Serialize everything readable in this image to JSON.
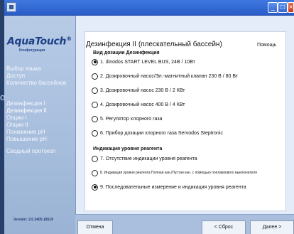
{
  "sidebar": {
    "logo": "AquaTouch",
    "logo_sub": "Конфигурация",
    "items_group1": [
      "Выбор языка",
      "Доступ",
      "Количество бассейнов"
    ],
    "items_group2": [
      "Дезинфекция I",
      "Дезинфекция II",
      "Опции I",
      "Опции II",
      "Понижение pH",
      "Повышение pH"
    ],
    "items_group3": [
      "Сводный протокол"
    ],
    "active_item": "Дезинфекция II",
    "version": "Version: 2.0.3405.18519"
  },
  "main": {
    "title": "Дезинфекция II (плескательный бассейн)",
    "help_label": "Помощь",
    "section1_title": "Вид дозации Дезинфекция",
    "dosing_options": [
      {
        "label": "1. dinodos START LEVEL BUS, 24В / 10Вт",
        "selected": true
      },
      {
        "label": "2. Дозировочный насос/Эл.-магнитный клапан 230 В / 80 Вт",
        "selected": false
      },
      {
        "label": "3. Дозировочный насос 230 В / 2 КВт",
        "selected": false
      },
      {
        "label": "4. Дозировочный насос 400 В / 4 КВт",
        "selected": false
      },
      {
        "label": "5. Регулятор хлорного газа",
        "selected": false
      },
      {
        "label": "6. Прибор дозации хлорного газа Servodos Steptronic",
        "selected": false
      }
    ],
    "section2_title": "Индикация уровня реагента",
    "level_options": [
      {
        "label": "7. Отсутствие индикации уровня реагента",
        "selected": false
      },
      {
        "label": "8. Индикация уровня реагента Полная кан./Пустая кан. с помощью поплавкового выключателя",
        "selected": false
      },
      {
        "label": "9. Последовательные измерение и индикация уровня реагента",
        "selected": true
      }
    ]
  },
  "footer": {
    "cancel_label": "Отмена",
    "back_label": "< Сброс",
    "next_label": "Далее >"
  }
}
